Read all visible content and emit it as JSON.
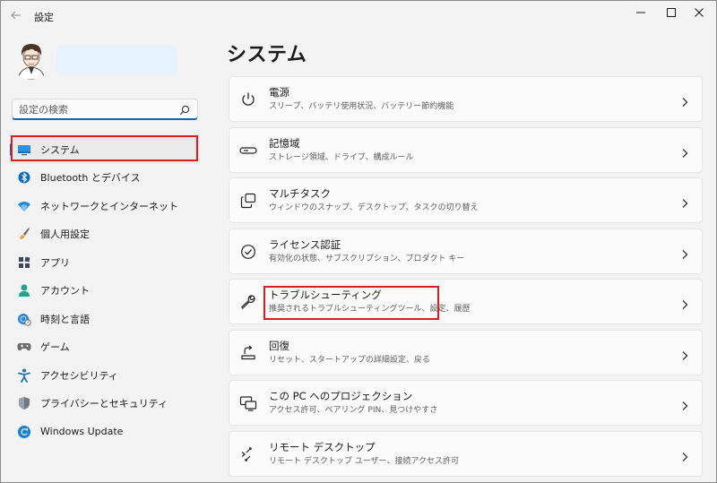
{
  "window": {
    "title": "設定"
  },
  "sidebar": {
    "search_placeholder": "設定の検索",
    "items": [
      {
        "label": "システム",
        "icon": "monitor-icon",
        "active": true
      },
      {
        "label": "Bluetooth とデバイス",
        "icon": "bluetooth-icon"
      },
      {
        "label": "ネットワークとインターネット",
        "icon": "wifi-icon"
      },
      {
        "label": "個人用設定",
        "icon": "brush-icon"
      },
      {
        "label": "アプリ",
        "icon": "apps-icon"
      },
      {
        "label": "アカウント",
        "icon": "person-icon"
      },
      {
        "label": "時刻と言語",
        "icon": "globe-clock-icon"
      },
      {
        "label": "ゲーム",
        "icon": "gamepad-icon"
      },
      {
        "label": "アクセシビリティ",
        "icon": "accessibility-icon"
      },
      {
        "label": "プライバシーとセキュリティ",
        "icon": "shield-icon"
      },
      {
        "label": "Windows Update",
        "icon": "update-icon"
      }
    ]
  },
  "main": {
    "title": "システム",
    "cards": [
      {
        "title": "電源",
        "subtitle": "スリープ、バッテリ使用状況、バッテリー節約機能",
        "icon": "power-icon"
      },
      {
        "title": "記憶域",
        "subtitle": "ストレージ領域、ドライブ、構成ルール",
        "icon": "storage-icon"
      },
      {
        "title": "マルチタスク",
        "subtitle": "ウィンドウのスナップ、デスクトップ、タスクの切り替え",
        "icon": "multitask-icon"
      },
      {
        "title": "ライセンス認証",
        "subtitle": "有効化の状態、サブスクリプション、プロダクト キー",
        "icon": "activation-icon"
      },
      {
        "title": "トラブルシューティング",
        "subtitle": "推奨されるトラブルシューティングツール、設定、履歴",
        "icon": "wrench-icon"
      },
      {
        "title": "回復",
        "subtitle": "リセット、スタートアップの詳細設定、戻る",
        "icon": "recovery-icon"
      },
      {
        "title": "この PC へのプロジェクション",
        "subtitle": "アクセス許可、ペアリング PIN、見つけやすさ",
        "icon": "projection-icon"
      },
      {
        "title": "リモート デスクトップ",
        "subtitle": "リモート デスクトップ ユーザー、接続アクセス許可",
        "icon": "remote-desktop-icon"
      }
    ]
  },
  "colors": {
    "accent": "#0067c0",
    "highlight": "#d81e1e",
    "background": "#f3f3f3",
    "card": "#fbfbfb"
  }
}
